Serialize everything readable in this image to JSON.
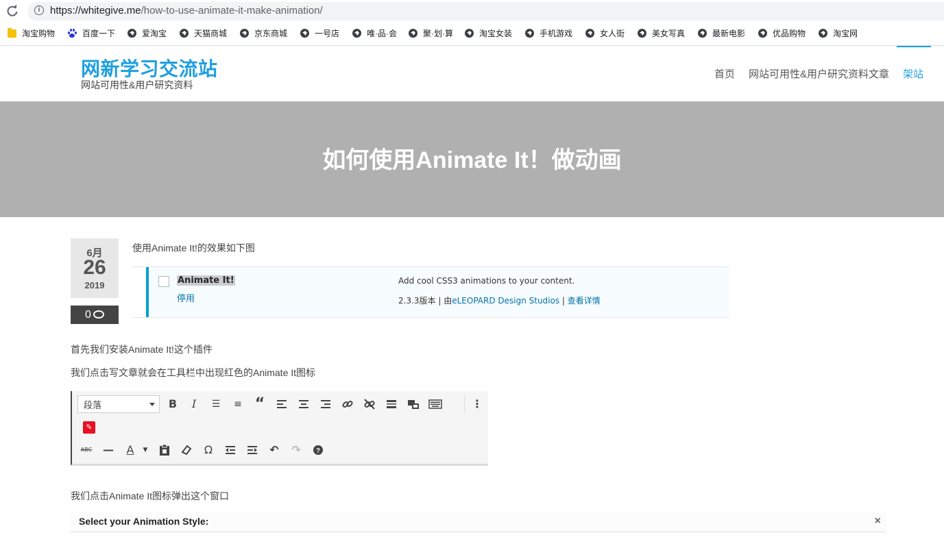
{
  "browser": {
    "url_host": "https://whitegive.me",
    "url_path": "/how-to-use-animate-it-make-animation/",
    "bookmarks": [
      "淘宝购物",
      "百度一下",
      "爱淘宝",
      "天猫商城",
      "京东商城",
      "一号店",
      "唯·品·会",
      "聚·划·算",
      "淘宝女装",
      "手机游戏",
      "女人街",
      "美女写真",
      "最新电影",
      "优品购物",
      "淘宝网"
    ]
  },
  "site": {
    "title": "网新学习交流站",
    "description": "网站可用性&用户研究资料",
    "nav": [
      "首页",
      "网站可用性&用户研究资料文章",
      "架站"
    ],
    "accent_color": "#1e9fe0"
  },
  "post": {
    "title": "如何使用Animate It！做动画",
    "date": {
      "month": "6月",
      "day": "26",
      "year": "2019"
    },
    "comments": "0",
    "paragraphs": [
      "使用Animate It!的效果如下图",
      "首先我们安装Animate It!这个插件",
      "我们点击写文章就会在工具栏中出现红色的Animate It图标",
      "我们点击Animate It图标弹出这个窗口"
    ]
  },
  "plugin": {
    "name": "Animate It!",
    "action": "停用",
    "description": "Add cool CSS3 animations to your content.",
    "version_text": "2.3.3版本 | 由",
    "author": "eLEOPARD Design Studios",
    "separator": " | ",
    "details_link": "查看详情"
  },
  "editor": {
    "format_select": "段落"
  },
  "modal": {
    "title": "Select your Animation Style:",
    "close": "×"
  }
}
